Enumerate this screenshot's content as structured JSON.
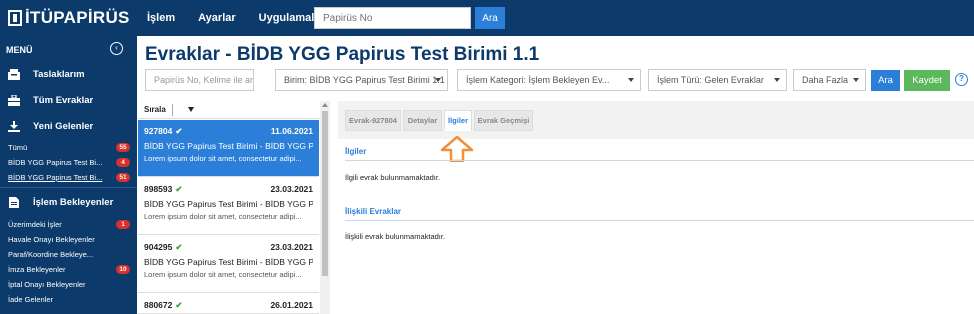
{
  "app": {
    "logo_text": "İTÜPAPİRÜS"
  },
  "topnav": {
    "items": [
      "İşlem",
      "Ayarlar",
      "Uygulamalar"
    ],
    "search_placeholder": "Papirüs No",
    "search_button": "Ara"
  },
  "sidebar": {
    "menu_label": "MENÜ",
    "main_items": [
      {
        "label": "Taslaklarım",
        "icon": "drafts-icon"
      },
      {
        "label": "Tüm Evraklar",
        "icon": "briefcase-icon"
      },
      {
        "label": "Yeni Gelenler",
        "icon": "download-icon"
      }
    ],
    "new_sub": [
      {
        "label": "Tümü",
        "badge": "55"
      },
      {
        "label": "BİDB YGG Papirus Test Bi...",
        "badge": "4"
      },
      {
        "label": "BİDB YGG Papirus Test Bi...",
        "badge": "51"
      }
    ],
    "pending_label": "İşlem Bekleyenler",
    "pending_icon": "document-icon",
    "pending_sub": [
      {
        "label": "Üzerimdeki İşler",
        "badge": "1"
      },
      {
        "label": "Havale Onayı Bekleyenler",
        "badge": ""
      },
      {
        "label": "Paraf/Koordine Bekleye...",
        "badge": ""
      },
      {
        "label": "İmza Bekleyenler",
        "badge": "10"
      },
      {
        "label": "İptal Onayı Bekleyenler",
        "badge": ""
      },
      {
        "label": "İade Gelenler",
        "badge": ""
      }
    ]
  },
  "page": {
    "title": "Evraklar - BİDB YGG Papirus Test Birimi 1.1"
  },
  "filters": {
    "search_placeholder": "Papirüs No, Kelime ile ara",
    "birim": "Birim:  BİDB YGG Papirus Test Birimi 1.1",
    "kategori": "İşlem Kategori:  İşlem Bekleyen Ev...",
    "tur": "İşlem Türü:  Gelen Evraklar",
    "more": "Daha Fazla",
    "ara": "Ara",
    "kaydet": "Kaydet",
    "help": "?"
  },
  "list": {
    "sort_label": "Sırala",
    "items": [
      {
        "no": "927804",
        "date": "11.06.2021",
        "title": "BİDB YGG Papirus Test Birimi - BİDB YGG P...",
        "desc": "Lorem ipsum dolor sit amet, consectetur adipi..."
      },
      {
        "no": "898593",
        "date": "23.03.2021",
        "title": "BİDB YGG Papirus Test Birimi - BİDB YGG P...",
        "desc": "Lorem ipsum dolor sit amet, consectetur adipi..."
      },
      {
        "no": "904295",
        "date": "23.03.2021",
        "title": "BİDB YGG Papirus Test Birimi - BİDB YGG P...",
        "desc": "Lorem ipsum dolor sit amet, consectetur adipi..."
      },
      {
        "no": "880672",
        "date": "26.01.2021",
        "title": "",
        "desc": ""
      }
    ]
  },
  "tabs": [
    "Evrak-927804",
    "Detaylar",
    "İlgiler",
    "Evrak Geçmişi"
  ],
  "detail": {
    "related_title": "İlgiler",
    "related_text": "İlgili evrak bulunmamaktadır.",
    "linked_title": "İlişkili Evraklar",
    "linked_text": "İlişkili evrak bulunmamaktadır."
  },
  "colors": {
    "navy": "#0c3a6b",
    "blue": "#2b7fd8",
    "green": "#5cb85c",
    "badge_red": "#d9302b",
    "arrow_orange": "#f0913a"
  }
}
